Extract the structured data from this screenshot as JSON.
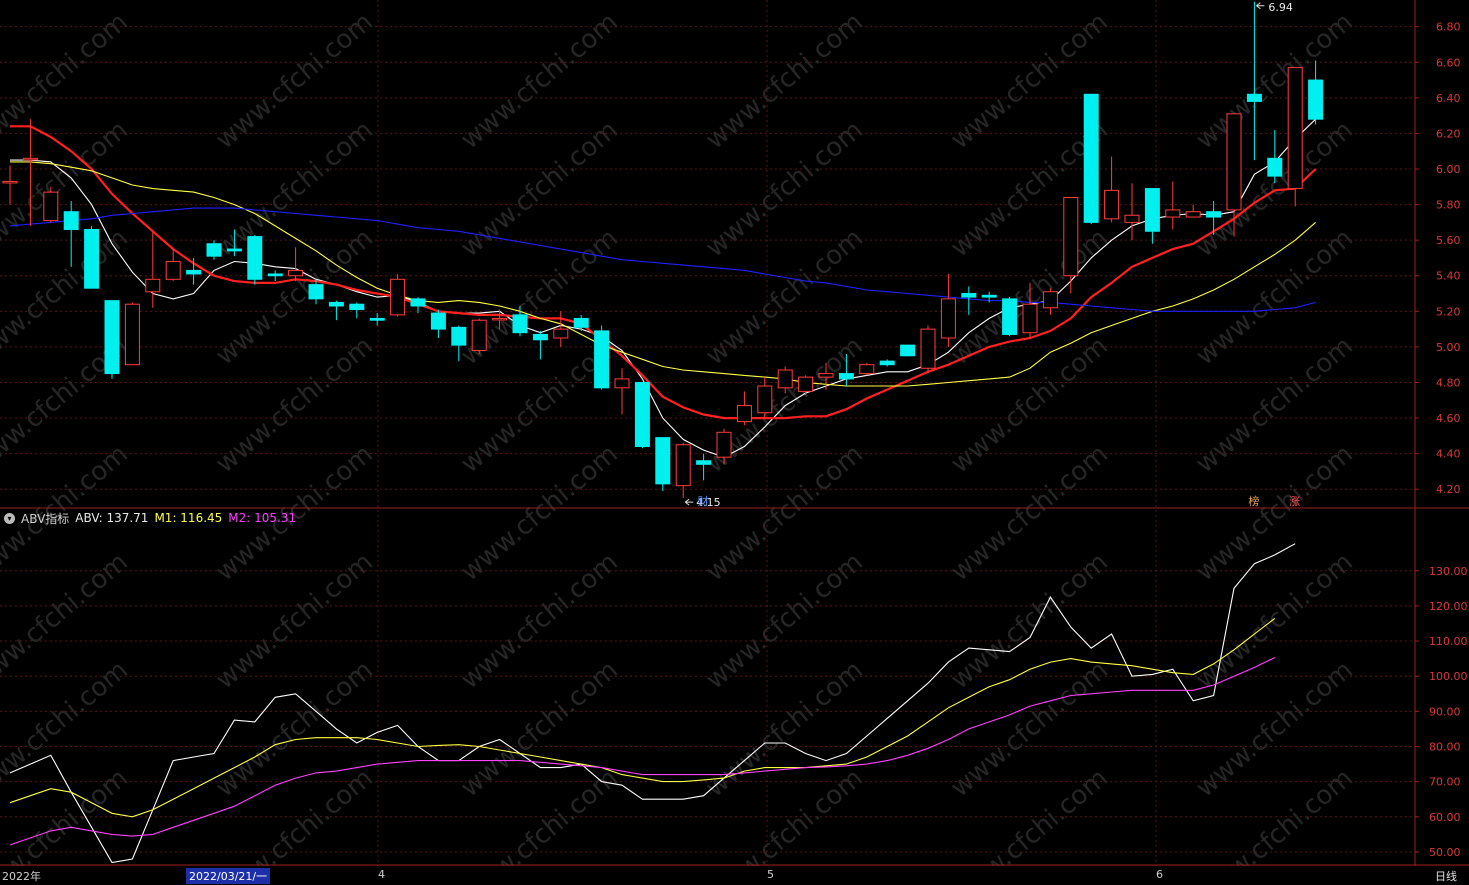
{
  "chart_data": [
    {
      "type": "candlestick",
      "ylim": [
        4.1,
        6.95
      ],
      "y_ticks": [
        "6.80",
        "6.60",
        "6.40",
        "6.20",
        "6.00",
        "5.80",
        "5.60",
        "5.40",
        "5.20",
        "5.00",
        "4.80",
        "4.60",
        "4.40",
        "4.20"
      ],
      "candles": [
        {
          "o": 5.93,
          "h": 6.02,
          "l": 5.8,
          "c": 5.93
        },
        {
          "o": 6.06,
          "h": 6.28,
          "l": 5.68,
          "c": 6.06
        },
        {
          "o": 5.71,
          "h": 5.9,
          "l": 5.7,
          "c": 5.87
        },
        {
          "o": 5.76,
          "h": 5.82,
          "l": 5.45,
          "c": 5.66
        },
        {
          "o": 5.66,
          "h": 5.68,
          "l": 5.33,
          "c": 5.33
        },
        {
          "o": 5.26,
          "h": 5.26,
          "l": 4.82,
          "c": 4.85
        },
        {
          "o": 4.9,
          "h": 5.25,
          "l": 4.9,
          "c": 5.24
        },
        {
          "o": 5.31,
          "h": 5.65,
          "l": 5.22,
          "c": 5.38
        },
        {
          "o": 5.38,
          "h": 5.55,
          "l": 5.37,
          "c": 5.48
        },
        {
          "o": 5.43,
          "h": 5.5,
          "l": 5.35,
          "c": 5.41
        },
        {
          "o": 5.58,
          "h": 5.6,
          "l": 5.49,
          "c": 5.51
        },
        {
          "o": 5.55,
          "h": 5.66,
          "l": 5.51,
          "c": 5.54
        },
        {
          "o": 5.62,
          "h": 5.63,
          "l": 5.35,
          "c": 5.38
        },
        {
          "o": 5.41,
          "h": 5.43,
          "l": 5.37,
          "c": 5.4
        },
        {
          "o": 5.4,
          "h": 5.56,
          "l": 5.37,
          "c": 5.43
        },
        {
          "o": 5.35,
          "h": 5.38,
          "l": 5.24,
          "c": 5.27
        },
        {
          "o": 5.25,
          "h": 5.26,
          "l": 5.15,
          "c": 5.23
        },
        {
          "o": 5.24,
          "h": 5.25,
          "l": 5.16,
          "c": 5.21
        },
        {
          "o": 5.16,
          "h": 5.19,
          "l": 5.12,
          "c": 5.15
        },
        {
          "o": 5.18,
          "h": 5.41,
          "l": 5.17,
          "c": 5.38
        },
        {
          "o": 5.27,
          "h": 5.28,
          "l": 5.19,
          "c": 5.23
        },
        {
          "o": 5.19,
          "h": 5.21,
          "l": 5.05,
          "c": 5.1
        },
        {
          "o": 5.11,
          "h": 5.12,
          "l": 4.92,
          "c": 5.01
        },
        {
          "o": 4.98,
          "h": 5.16,
          "l": 4.96,
          "c": 5.15
        },
        {
          "o": 5.16,
          "h": 5.21,
          "l": 5.1,
          "c": 5.16
        },
        {
          "o": 5.18,
          "h": 5.23,
          "l": 5.06,
          "c": 5.08
        },
        {
          "o": 5.07,
          "h": 5.09,
          "l": 4.93,
          "c": 5.04
        },
        {
          "o": 5.05,
          "h": 5.2,
          "l": 5.0,
          "c": 5.1
        },
        {
          "o": 5.16,
          "h": 5.18,
          "l": 5.09,
          "c": 5.11
        },
        {
          "o": 5.09,
          "h": 5.12,
          "l": 4.76,
          "c": 4.77
        },
        {
          "o": 4.77,
          "h": 4.88,
          "l": 4.62,
          "c": 4.82
        },
        {
          "o": 4.8,
          "h": 4.8,
          "l": 4.43,
          "c": 4.44
        },
        {
          "o": 4.49,
          "h": 4.49,
          "l": 4.19,
          "c": 4.23
        },
        {
          "o": 4.22,
          "h": 4.46,
          "l": 4.15,
          "c": 4.45
        },
        {
          "o": 4.36,
          "h": 4.4,
          "l": 4.25,
          "c": 4.34
        },
        {
          "o": 4.38,
          "h": 4.54,
          "l": 4.34,
          "c": 4.52
        },
        {
          "o": 4.58,
          "h": 4.75,
          "l": 4.56,
          "c": 4.67
        },
        {
          "o": 4.63,
          "h": 4.83,
          "l": 4.6,
          "c": 4.78
        },
        {
          "o": 4.77,
          "h": 4.89,
          "l": 4.74,
          "c": 4.87
        },
        {
          "o": 4.75,
          "h": 4.84,
          "l": 4.73,
          "c": 4.83
        },
        {
          "o": 4.83,
          "h": 4.91,
          "l": 4.76,
          "c": 4.85
        },
        {
          "o": 4.85,
          "h": 4.96,
          "l": 4.78,
          "c": 4.82
        },
        {
          "o": 4.85,
          "h": 4.91,
          "l": 4.84,
          "c": 4.9
        },
        {
          "o": 4.92,
          "h": 4.93,
          "l": 4.89,
          "c": 4.9
        },
        {
          "o": 5.01,
          "h": 5.01,
          "l": 4.95,
          "c": 4.95
        },
        {
          "o": 4.88,
          "h": 5.12,
          "l": 4.85,
          "c": 5.1
        },
        {
          "o": 5.05,
          "h": 5.41,
          "l": 5.0,
          "c": 5.27
        },
        {
          "o": 5.3,
          "h": 5.34,
          "l": 5.18,
          "c": 5.28
        },
        {
          "o": 5.29,
          "h": 5.31,
          "l": 5.25,
          "c": 5.28
        },
        {
          "o": 5.27,
          "h": 5.28,
          "l": 5.06,
          "c": 5.07
        },
        {
          "o": 5.08,
          "h": 5.36,
          "l": 5.05,
          "c": 5.24
        },
        {
          "o": 5.22,
          "h": 5.33,
          "l": 5.18,
          "c": 5.31
        },
        {
          "o": 5.4,
          "h": 5.84,
          "l": 5.3,
          "c": 5.84
        },
        {
          "o": 6.42,
          "h": 6.42,
          "l": 5.69,
          "c": 5.7
        },
        {
          "o": 5.72,
          "h": 6.07,
          "l": 5.7,
          "c": 5.88
        },
        {
          "o": 5.7,
          "h": 5.92,
          "l": 5.6,
          "c": 5.74
        },
        {
          "o": 5.89,
          "h": 5.89,
          "l": 5.58,
          "c": 5.65
        },
        {
          "o": 5.73,
          "h": 5.93,
          "l": 5.66,
          "c": 5.77
        },
        {
          "o": 5.73,
          "h": 5.8,
          "l": 5.73,
          "c": 5.76
        },
        {
          "o": 5.76,
          "h": 5.82,
          "l": 5.63,
          "c": 5.73
        },
        {
          "o": 5.77,
          "h": 6.12,
          "l": 5.62,
          "c": 6.31
        },
        {
          "o": 6.42,
          "h": 6.94,
          "l": 6.05,
          "c": 6.38
        },
        {
          "o": 6.06,
          "h": 6.22,
          "l": 5.92,
          "c": 5.96
        },
        {
          "o": 5.89,
          "h": 6.57,
          "l": 5.79,
          "c": 6.57
        },
        {
          "o": 6.5,
          "h": 6.61,
          "l": 6.25,
          "c": 6.28
        }
      ],
      "ma": [
        {
          "color": "#ffffff",
          "values": [
            6.05,
            6.05,
            6.04,
            5.95,
            5.8,
            5.58,
            5.42,
            5.3,
            5.27,
            5.3,
            5.43,
            5.48,
            5.47,
            5.45,
            5.44,
            5.38,
            5.35,
            5.31,
            5.28,
            5.29,
            5.25,
            5.2,
            5.19,
            5.19,
            5.2,
            5.12,
            5.08,
            5.12,
            5.1,
            5.06,
            4.98,
            4.82,
            4.6,
            4.48,
            4.42,
            4.38,
            4.44,
            4.55,
            4.67,
            4.74,
            4.78,
            4.82,
            4.84,
            4.86,
            4.86,
            4.9,
            4.97,
            5.08,
            5.16,
            5.22,
            5.24,
            5.26,
            5.37,
            5.5,
            5.6,
            5.68,
            5.72,
            5.74,
            5.75,
            5.74,
            5.76,
            5.97,
            6.04,
            6.17,
            6.28
          ]
        },
        {
          "color": "#ff2020",
          "values": [
            6.24,
            6.24,
            6.18,
            6.1,
            6.0,
            5.86,
            5.75,
            5.65,
            5.55,
            5.47,
            5.4,
            5.37,
            5.36,
            5.36,
            5.38,
            5.37,
            5.35,
            5.32,
            5.3,
            5.28,
            5.24,
            5.2,
            5.19,
            5.18,
            5.18,
            5.17,
            5.16,
            5.16,
            5.13,
            5.04,
            4.95,
            4.84,
            4.72,
            4.66,
            4.62,
            4.6,
            4.6,
            4.6,
            4.6,
            4.61,
            4.61,
            4.65,
            4.71,
            4.76,
            4.81,
            4.86,
            4.9,
            4.95,
            5.0,
            5.03,
            5.05,
            5.09,
            5.16,
            5.28,
            5.36,
            5.45,
            5.5,
            5.55,
            5.58,
            5.65,
            5.72,
            5.81,
            5.88,
            5.89,
            6.0
          ]
        },
        {
          "color": "#ffff40",
          "values": [
            6.04,
            6.04,
            6.03,
            6.01,
            5.99,
            5.95,
            5.91,
            5.89,
            5.88,
            5.87,
            5.84,
            5.8,
            5.75,
            5.68,
            5.61,
            5.54,
            5.46,
            5.39,
            5.33,
            5.29,
            5.26,
            5.25,
            5.26,
            5.25,
            5.23,
            5.2,
            5.16,
            5.13,
            5.07,
            5.01,
            4.97,
            4.93,
            4.89,
            4.87,
            4.86,
            4.85,
            4.84,
            4.83,
            4.82,
            4.8,
            4.79,
            4.78,
            4.78,
            4.78,
            4.78,
            4.79,
            4.8,
            4.81,
            4.82,
            4.83,
            4.88,
            4.97,
            5.02,
            5.08,
            5.12,
            5.16,
            5.2,
            5.23,
            5.27,
            5.32,
            5.38,
            5.45,
            5.52,
            5.6,
            5.7
          ]
        },
        {
          "color": "#2020ff",
          "values": [
            5.68,
            5.69,
            5.7,
            5.71,
            5.72,
            5.74,
            5.75,
            5.76,
            5.77,
            5.78,
            5.78,
            5.78,
            5.77,
            5.76,
            5.75,
            5.74,
            5.73,
            5.72,
            5.71,
            5.69,
            5.67,
            5.66,
            5.65,
            5.63,
            5.61,
            5.59,
            5.57,
            5.55,
            5.53,
            5.51,
            5.49,
            5.48,
            5.47,
            5.46,
            5.45,
            5.44,
            5.43,
            5.41,
            5.39,
            5.37,
            5.36,
            5.34,
            5.32,
            5.31,
            5.3,
            5.29,
            5.28,
            5.27,
            5.26,
            5.26,
            5.25,
            5.25,
            5.24,
            5.23,
            5.22,
            5.21,
            5.2,
            5.2,
            5.2,
            5.2,
            5.2,
            5.2,
            5.21,
            5.22,
            5.25
          ]
        }
      ],
      "annotations": [
        {
          "text": "6.94",
          "index": 61,
          "price": 6.94
        },
        {
          "text": "4.15",
          "index": 33,
          "price": 4.15
        }
      ],
      "markers": [
        {
          "text": "财",
          "index": 34,
          "color": "#5599ff"
        },
        {
          "text": "榜",
          "index": 61,
          "color": "#e0a050"
        },
        {
          "text": "涨",
          "index": 63,
          "color": "#ff5050"
        }
      ]
    },
    {
      "type": "line",
      "name": "ABV指标",
      "ylim": [
        46,
        147
      ],
      "y_ticks": [
        "130.00",
        "120.00",
        "110.00",
        "100.00",
        "90.00",
        "80.00",
        "70.00",
        "60.00",
        "50.00"
      ],
      "series": [
        {
          "name": "ABV",
          "current": "137.71",
          "color": "#ffffff",
          "values": [
            72.5,
            75,
            77.5,
            67,
            57,
            47,
            48,
            62,
            76,
            77,
            78,
            87.5,
            87,
            94,
            95,
            90,
            85,
            81,
            84,
            86,
            80,
            76,
            76,
            80,
            82,
            78,
            74,
            74,
            75,
            70,
            69,
            65,
            65,
            65,
            66,
            71,
            76,
            81,
            81,
            78,
            76,
            78,
            83,
            88,
            93,
            98,
            104,
            108,
            107.5,
            107,
            111,
            122.5,
            114,
            108,
            112,
            100,
            100.5,
            102,
            93,
            94.5,
            125,
            132,
            134.5,
            137.7
          ]
        },
        {
          "name": "M1",
          "current": "116.45",
          "color": "#ffff40",
          "values": [
            64,
            66,
            68,
            67,
            64,
            61,
            60,
            62,
            65,
            68,
            71,
            74,
            77,
            80.5,
            82,
            82.5,
            82.5,
            82.5,
            82,
            81,
            80,
            80.3,
            80.5,
            80,
            79,
            78,
            77,
            76,
            75,
            74,
            72,
            71,
            70,
            70,
            70.5,
            71,
            73,
            74,
            74,
            74,
            74.5,
            75,
            77,
            80,
            83,
            87,
            91,
            94,
            97,
            99,
            102,
            104,
            105,
            104,
            103.5,
            103,
            102,
            101,
            100.5,
            103.5,
            107.5,
            112,
            116.45
          ]
        },
        {
          "name": "M2",
          "current": "105.31",
          "color": "#ff40ff",
          "values": [
            52,
            54,
            56,
            57,
            56,
            55,
            54.5,
            55,
            57,
            59,
            61,
            63,
            66,
            69,
            71,
            72.5,
            73,
            74,
            75,
            75.5,
            76,
            76,
            76,
            76,
            76,
            76,
            75.5,
            75,
            74.5,
            74,
            73,
            72,
            72,
            72,
            72,
            72,
            72.5,
            73,
            73.5,
            74,
            74.2,
            74.5,
            75,
            76,
            77.5,
            79.5,
            82,
            85,
            87,
            89,
            91.5,
            93,
            94.5,
            95,
            95.5,
            96,
            96,
            96,
            96,
            97.5,
            100,
            102.5,
            105.31
          ]
        }
      ]
    }
  ],
  "indicator_header": {
    "name": "ABV指标",
    "abv_label": "ABV: 137.71",
    "m1_label": "M1: 116.45",
    "m2_label": "M2: 105.31"
  },
  "x_axis": {
    "year_label": "2022年",
    "cursor_date": "2022/03/21/一",
    "month_4": "4",
    "month_5": "5",
    "month_6": "6",
    "period": "日线"
  },
  "watermark": "www.cfchi.com"
}
